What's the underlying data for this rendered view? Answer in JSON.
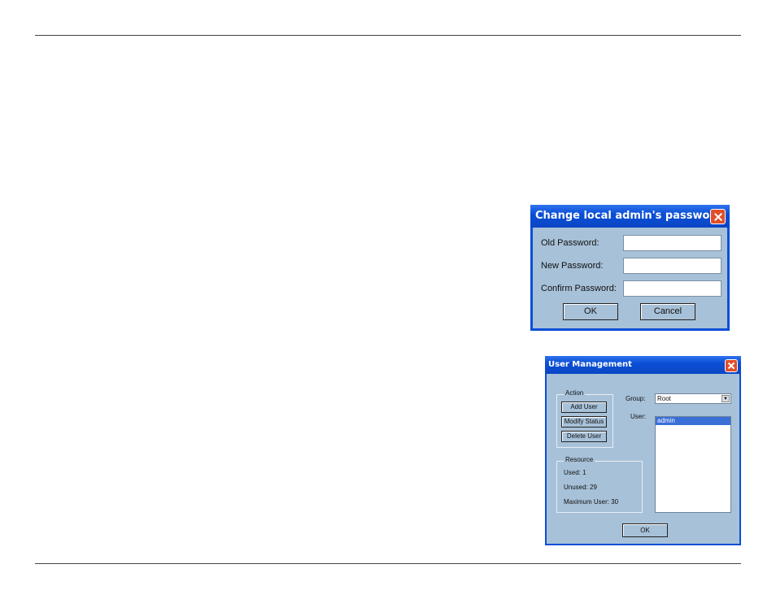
{
  "password_dialog": {
    "title": "Change local admin's password",
    "old_label": "Old Password:",
    "new_label": "New Password:",
    "confirm_label": "Confirm Password:",
    "old_value": "",
    "new_value": "",
    "confirm_value": "",
    "ok_label": "OK",
    "cancel_label": "Cancel"
  },
  "user_dialog": {
    "title": "User Management",
    "action_label": "Action",
    "add_user": "Add User",
    "modify_status": "Modify Status",
    "delete_user": "Delete User",
    "group_label": "Group:",
    "group_value": "Root",
    "user_label": "User:",
    "users": [
      "admin"
    ],
    "resource_label": "Resource",
    "used": "Used:  1",
    "unused": "Unused:  29",
    "maximum": "Maximum User:  30",
    "ok_label": "OK"
  },
  "icons": {
    "close": "close-icon",
    "dropdown": "chevron-down-icon"
  }
}
